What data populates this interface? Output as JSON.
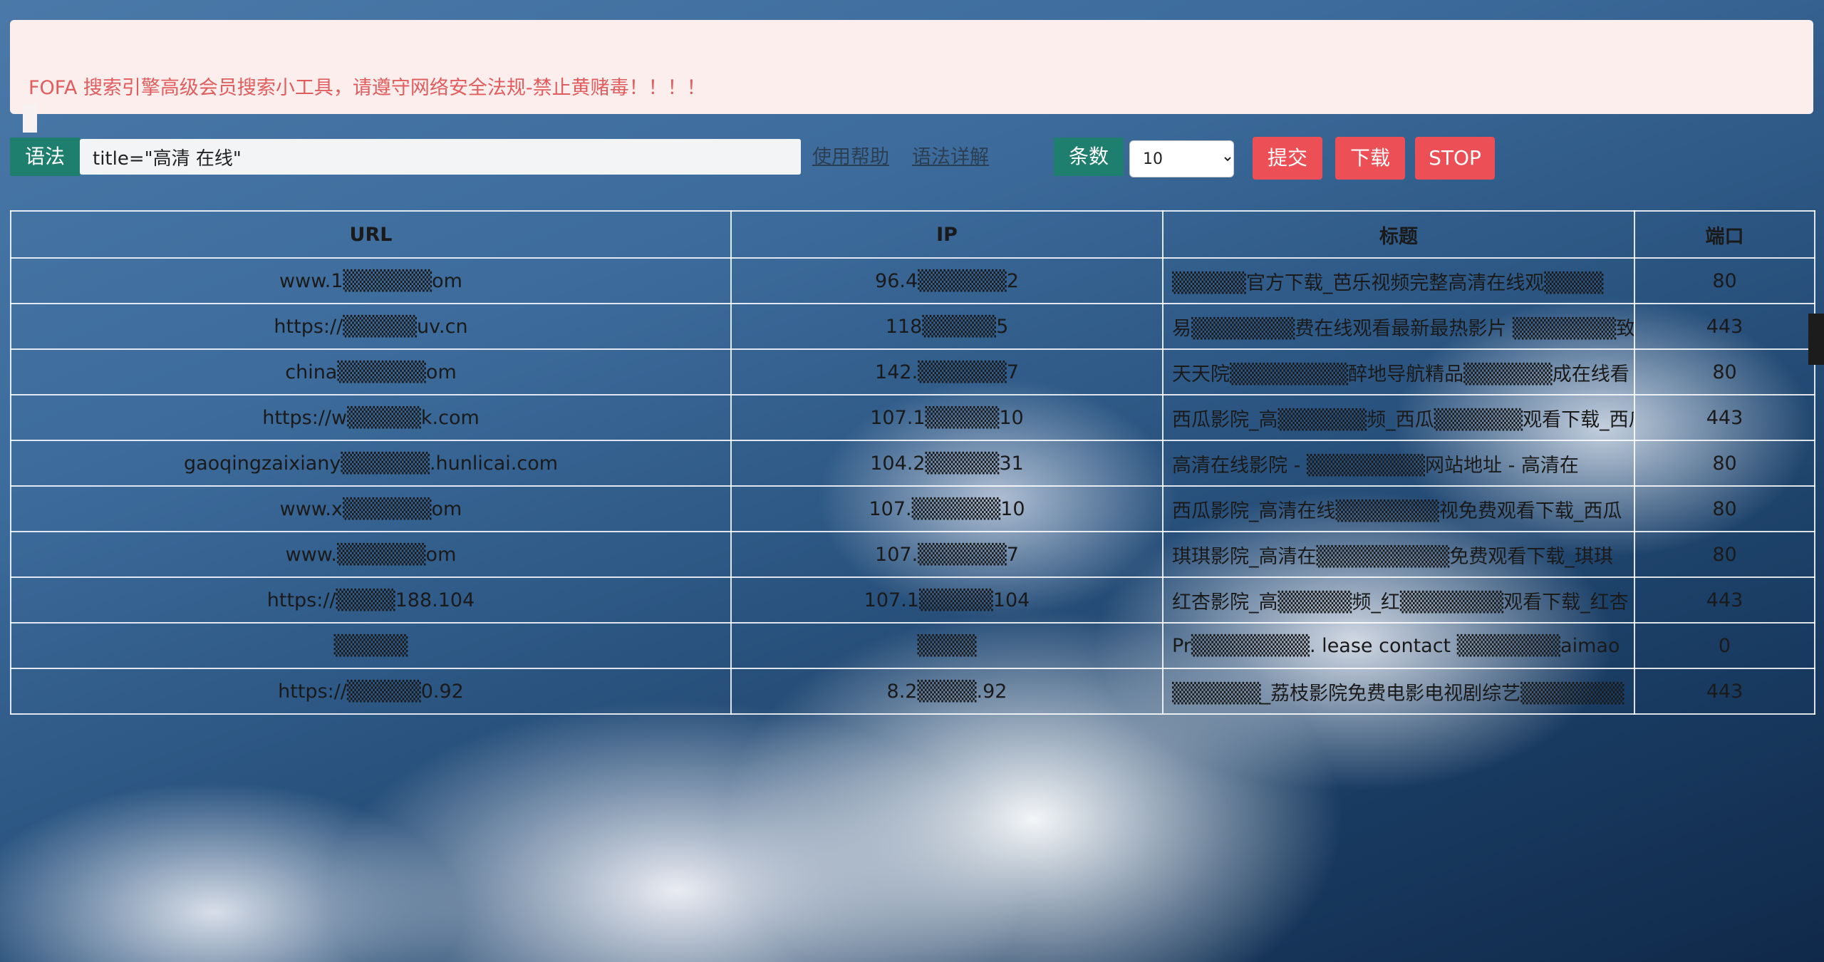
{
  "alert": {
    "text": "FOFA 搜索引擎高级会员搜索小工具，请遵守网络安全法规-禁止黄赌毒！！！！"
  },
  "toolbar": {
    "syntax_label": "语法",
    "query_value": "title=\"高清 在线\"",
    "help_link": "使用帮助",
    "syntax_detail_link": "语法详解",
    "count_label": "条数",
    "count_selected": "10",
    "submit_label": "提交",
    "download_label": "下载",
    "stop_label": "STOP"
  },
  "table": {
    "headers": [
      "URL",
      "IP",
      "标题",
      "端口"
    ],
    "rows": [
      {
        "url": "www.1▒▒▒▒▒▒om",
        "ip": "96.4▒▒▒▒▒▒2",
        "title": "▒▒▒▒▒官方下载_芭乐视频完整高清在线观▒▒▒▒",
        "port": "80"
      },
      {
        "url": "https://▒▒▒▒▒uv.cn",
        "ip": "118▒▒▒▒▒5",
        "title": "易▒▒▒▒▒▒▒费在线观看最新最热影片 ▒▒▒▒▒▒▒致",
        "port": "443"
      },
      {
        "url": "china▒▒▒▒▒▒om",
        "ip": "142.▒▒▒▒▒▒7",
        "title": "天天院▒▒▒▒▒▒▒▒醉地导航精品▒▒▒▒▒▒成在线看",
        "port": "80"
      },
      {
        "url": "https://w▒▒▒▒▒k.com",
        "ip": "107.1▒▒▒▒▒10",
        "title": "西瓜影院_高▒▒▒▒▒▒频_西瓜▒▒▒▒▒▒观看下载_西瓜",
        "port": "443"
      },
      {
        "url": "gaoqingzaixiany▒▒▒▒▒▒.hunlicai.com",
        "ip": "104.2▒▒▒▒▒31",
        "title": "高清在线影院 - ▒▒▒▒▒▒▒▒网站地址 - 高清在",
        "port": "80"
      },
      {
        "url": "www.x▒▒▒▒▒▒om",
        "ip": "107.▒▒▒▒▒▒10",
        "title": "西瓜影院_高清在线▒▒▒▒▒▒▒视免费观看下载_西瓜",
        "port": "80"
      },
      {
        "url": "www.▒▒▒▒▒▒om",
        "ip": "107.▒▒▒▒▒▒7",
        "title": "琪琪影院_高清在▒▒▒▒▒▒▒▒▒免费观看下载_琪琪",
        "port": "80"
      },
      {
        "url": "https://▒▒▒▒188.104",
        "ip": "107.1▒▒▒▒▒104",
        "title": "红杏影院_高▒▒▒▒▒频_红▒▒▒▒▒▒▒观看下载_红杏",
        "port": "443"
      },
      {
        "url": "▒▒▒▒▒",
        "ip": "▒▒▒▒",
        "title": "Pr▒▒▒▒▒▒▒▒. lease contact ▒▒▒▒▒▒▒aimao",
        "port": "0"
      },
      {
        "url": "https://▒▒▒▒▒0.92",
        "ip": "8.2▒▒▒▒.92",
        "title": "▒▒▒▒▒▒_荔枝影院免费电影电视剧综艺▒▒▒▒▒▒▒",
        "port": "443"
      }
    ]
  }
}
